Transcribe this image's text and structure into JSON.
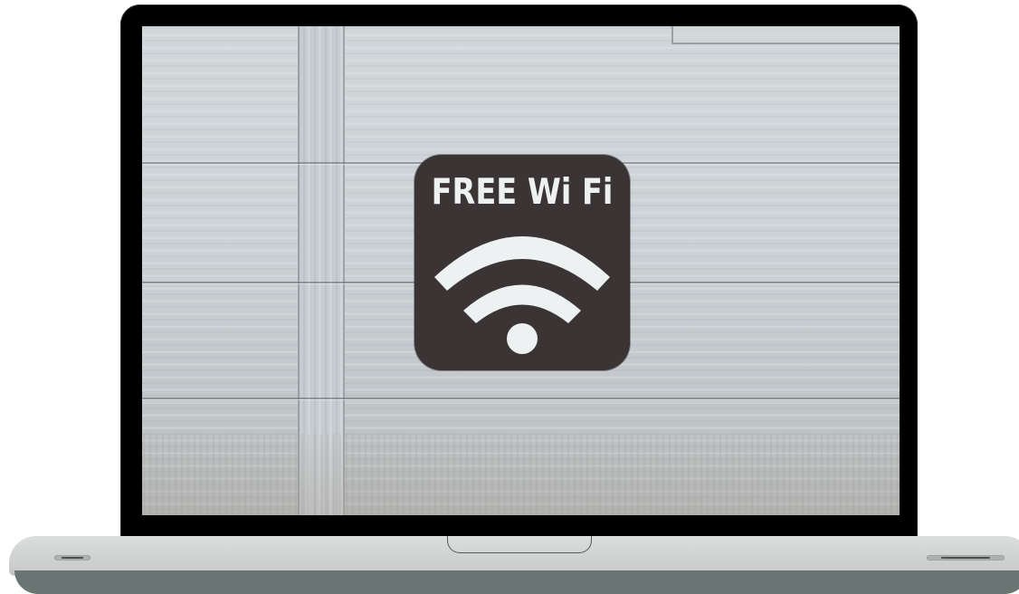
{
  "sign": {
    "text": "FREE Wi Fi",
    "icon": "wifi-icon"
  },
  "colors": {
    "bezel": "#000000",
    "wall": "#cdd3d6",
    "sign_background": "#3a3435",
    "sign_foreground": "#eef1f2",
    "laptop_base": "#d6d8d7",
    "laptop_base_bottom": "#687572"
  }
}
